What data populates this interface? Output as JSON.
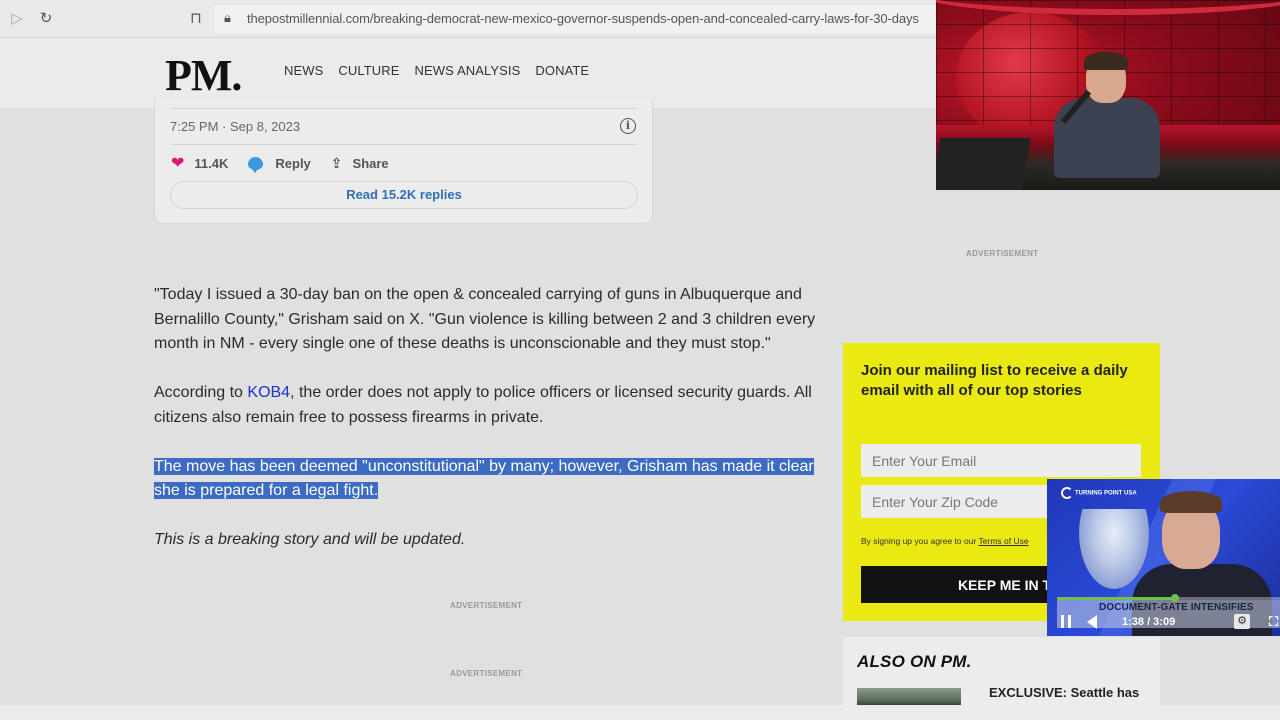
{
  "browser": {
    "url": "thepostmillennial.com/breaking-democrat-new-mexico-governor-suspends-open-and-concealed-carry-laws-for-30-days",
    "icons": {
      "back": "play-forward-icon",
      "reload": "reload-icon",
      "bookmark": "bookmark-icon",
      "lock": "lock-icon"
    }
  },
  "site": {
    "logo": "PM.",
    "nav": [
      "NEWS",
      "CULTURE",
      "NEWS ANALYSIS",
      "DONATE"
    ]
  },
  "tweet": {
    "timestamp": "7:25 PM · Sep 8, 2023",
    "likes": "11.4K",
    "reply_label": "Reply",
    "share_label": "Share",
    "read_replies": "Read 15.2K replies"
  },
  "article": {
    "p1": "\"Today I issued a 30-day ban on the open & concealed carrying of guns in Albuquerque and Bernalillo County,\" Grisham said on X. \"Gun violence is killing between 2 and 3 children every month in NM - every single one of these deaths is unconscionable and they must stop.\"",
    "p2_prefix": "According to ",
    "p2_link": "KOB4",
    "p2_suffix": ", the order does not apply to police officers or licensed security guards. All citizens also remain free to possess firearms in private.",
    "p3_highlighted": "The move has been deemed \"unconstitutional\" by many; however, Grisham has made it clear she is prepared for a legal fight.",
    "p4": "This is a breaking story and will be updated.",
    "ad_label": "ADVERTISEMENT"
  },
  "sidebar": {
    "ad_label": "ADVERTISEMENT",
    "newsletter": {
      "headline": "Join our mailing list to receive a daily email with all of our top stories",
      "email_placeholder": "Enter Your Email",
      "zip_placeholder": "Enter Your Zip Code",
      "terms_prefix": "By signing up you agree to our ",
      "terms_link": "Terms of Use",
      "submit_label": "KEEP ME IN THE LOOP"
    },
    "also_on": {
      "title": "ALSO ON PM.",
      "story_title": "EXCLUSIVE: Seattle has"
    }
  },
  "video_player": {
    "channel_logo": "TURNING POINT USA",
    "headline": "DOCUMENT-GATE INTENSIFIES",
    "time": "1:38 / 3:09",
    "progress_fraction": 0.53,
    "icons": {
      "pause": "pause-icon",
      "volume": "volume-icon",
      "settings": "gear-icon",
      "fullscreen": "fullscreen-icon"
    }
  },
  "colors": {
    "accent_yellow": "#eaea12",
    "highlight_blue": "#3d6bc4",
    "link_blue": "#1a33d0",
    "like_pink": "#e0156f",
    "reply_blue": "#3a9ae0",
    "progress_green": "#6cc24a"
  }
}
